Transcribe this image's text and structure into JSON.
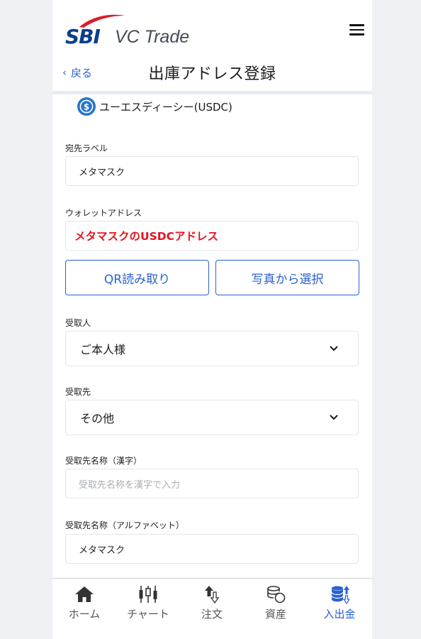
{
  "header": {
    "logo_text_bold": "SBI",
    "logo_text": "VC Trade"
  },
  "subheader": {
    "back_label": "戻る",
    "title": "出庫アドレス登録"
  },
  "coin": {
    "name": "ユーエスディーシー(USDC)",
    "icon": "usdc-coin-icon",
    "icon_color": "#2775ca"
  },
  "form": {
    "dest_label": {
      "label": "宛先ラベル",
      "value": "メタマスク"
    },
    "wallet_address": {
      "label": "ウォレットアドレス",
      "value": "メタマスクのUSDCアドレス",
      "value_color": "#e6131d"
    },
    "buttons": {
      "qr": "QR読み取り",
      "photo": "写真から選択"
    },
    "recipient": {
      "label": "受取人",
      "value": "ご本人様"
    },
    "destination": {
      "label": "受取先",
      "value": "その他"
    },
    "dest_name_kanji": {
      "label": "受取先名称（漢字）",
      "placeholder": "受取先名称を漢字で入力"
    },
    "dest_name_alpha": {
      "label": "受取先名称（アルファベット）",
      "value": "メタマスク"
    }
  },
  "bottom_nav": {
    "items": [
      {
        "label": "ホーム",
        "icon": "home-icon"
      },
      {
        "label": "チャート",
        "icon": "chart-icon"
      },
      {
        "label": "注文",
        "icon": "order-icon"
      },
      {
        "label": "資産",
        "icon": "assets-icon"
      },
      {
        "label": "入出金",
        "icon": "deposit-withdraw-icon",
        "active": true
      }
    ],
    "active_color": "#2a62d1"
  }
}
